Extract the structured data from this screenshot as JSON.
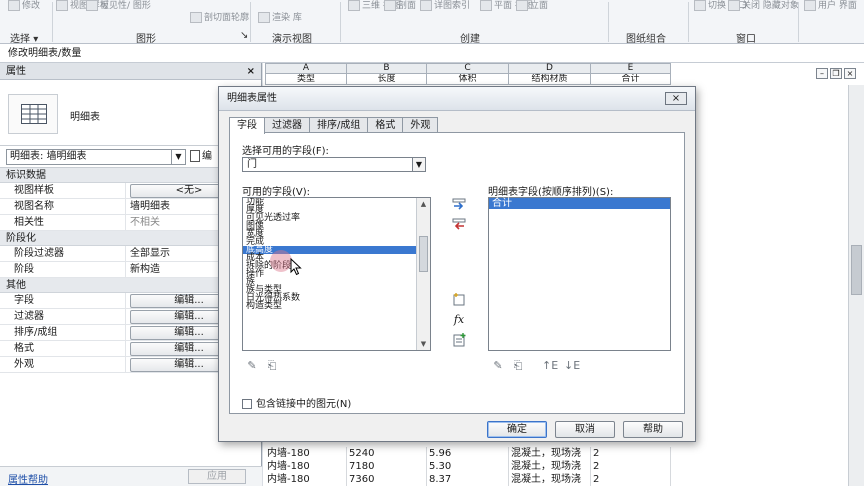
{
  "ribbon": {
    "tools": [
      {
        "label": "修改",
        "icon": "modify-icon"
      },
      {
        "label": "视图\n样板",
        "icon": "view-template-icon"
      },
      {
        "label": "可见性/\n图形",
        "icon": "visibility-icon"
      },
      {
        "label": "剖切面轮廓",
        "icon": "cut-profile-icon"
      },
      {
        "label": "渲染 库",
        "icon": "render-icon"
      },
      {
        "label": "三维\n视图",
        "icon": "3d-view-icon"
      },
      {
        "label": "剖面",
        "icon": "section-icon"
      },
      {
        "label": "详图索引",
        "icon": "callout-icon"
      },
      {
        "label": "平面\n视图",
        "icon": "plan-view-icon"
      },
      {
        "label": "立面",
        "icon": "elevation-icon"
      },
      {
        "label": "切换\n窗口",
        "icon": "switch-window-icon"
      },
      {
        "label": "关闭\n隐藏对象",
        "icon": "close-hidden-icon"
      },
      {
        "label": "用户\n界面",
        "icon": "user-interface-icon"
      }
    ],
    "groups": {
      "select": "选择",
      "graphics": "图形",
      "presentation": "演示视图",
      "create": "创建",
      "sheet": "图纸组合",
      "window": "窗口"
    }
  },
  "title_strip": "修改明细表/数量",
  "properties": {
    "header": "属性",
    "close_glyph": "×",
    "type_name": "明细表",
    "selector_value": "明细表: 墙明细表",
    "edit_type": "编",
    "categories": [
      {
        "name": "标识数据",
        "rows": [
          {
            "key": "视图样板",
            "button": "<无>"
          },
          {
            "key": "视图名称",
            "value": "墙明细表"
          },
          {
            "key": "相关性",
            "value": "不相关",
            "gray": true
          }
        ]
      },
      {
        "name": "阶段化",
        "rows": [
          {
            "key": "阶段过滤器",
            "value": "全部显示"
          },
          {
            "key": "阶段",
            "value": "新构造"
          }
        ]
      },
      {
        "name": "其他",
        "rows": [
          {
            "key": "字段",
            "button": "编辑..."
          },
          {
            "key": "过滤器",
            "button": "编辑..."
          },
          {
            "key": "排序/成组",
            "button": "编辑..."
          },
          {
            "key": "格式",
            "button": "编辑..."
          },
          {
            "key": "外观",
            "button": "编辑..."
          }
        ]
      }
    ],
    "help_link": "属性帮助",
    "apply": "应用"
  },
  "schedule": {
    "columns": [
      "A",
      "B",
      "C",
      "D",
      "E"
    ],
    "fields": [
      "类型",
      "长度",
      "体积",
      "结构材质",
      "合计"
    ],
    "rows": [
      [
        "内墙-180",
        "5240",
        "5.96",
        "混凝土，现场浇",
        "2"
      ],
      [
        "内墙-180",
        "7180",
        "5.30",
        "混凝土，现场浇",
        "2"
      ],
      [
        "内墙-180",
        "7360",
        "8.37",
        "混凝土，现场浇",
        "2"
      ]
    ]
  },
  "dialog": {
    "title": "明细表属性",
    "close_glyph": "×",
    "tabs": [
      "字段",
      "过滤器",
      "排序/成组",
      "格式",
      "外观"
    ],
    "active_tab": 0,
    "select_from_label": "选择可用的字段(F):",
    "select_from_value": "门",
    "available_label": "可用的字段(V):",
    "available_fields": [
      "功能",
      "厚度",
      "可见光透过率",
      "图像",
      "宽度",
      "完成",
      "底高度",
      "成本",
      "拆除的阶段",
      "操作",
      "族",
      "族与类型",
      "日光得热系数",
      "构造类型"
    ],
    "selected_index": 6,
    "schedule_fields_label": "明细表字段(按顺序排列)(S):",
    "schedule_fields": [
      "合计"
    ],
    "include_links": "包含链接中的图元(N)",
    "buttons": {
      "ok": "确定",
      "cancel": "取消",
      "help": "帮助"
    }
  }
}
